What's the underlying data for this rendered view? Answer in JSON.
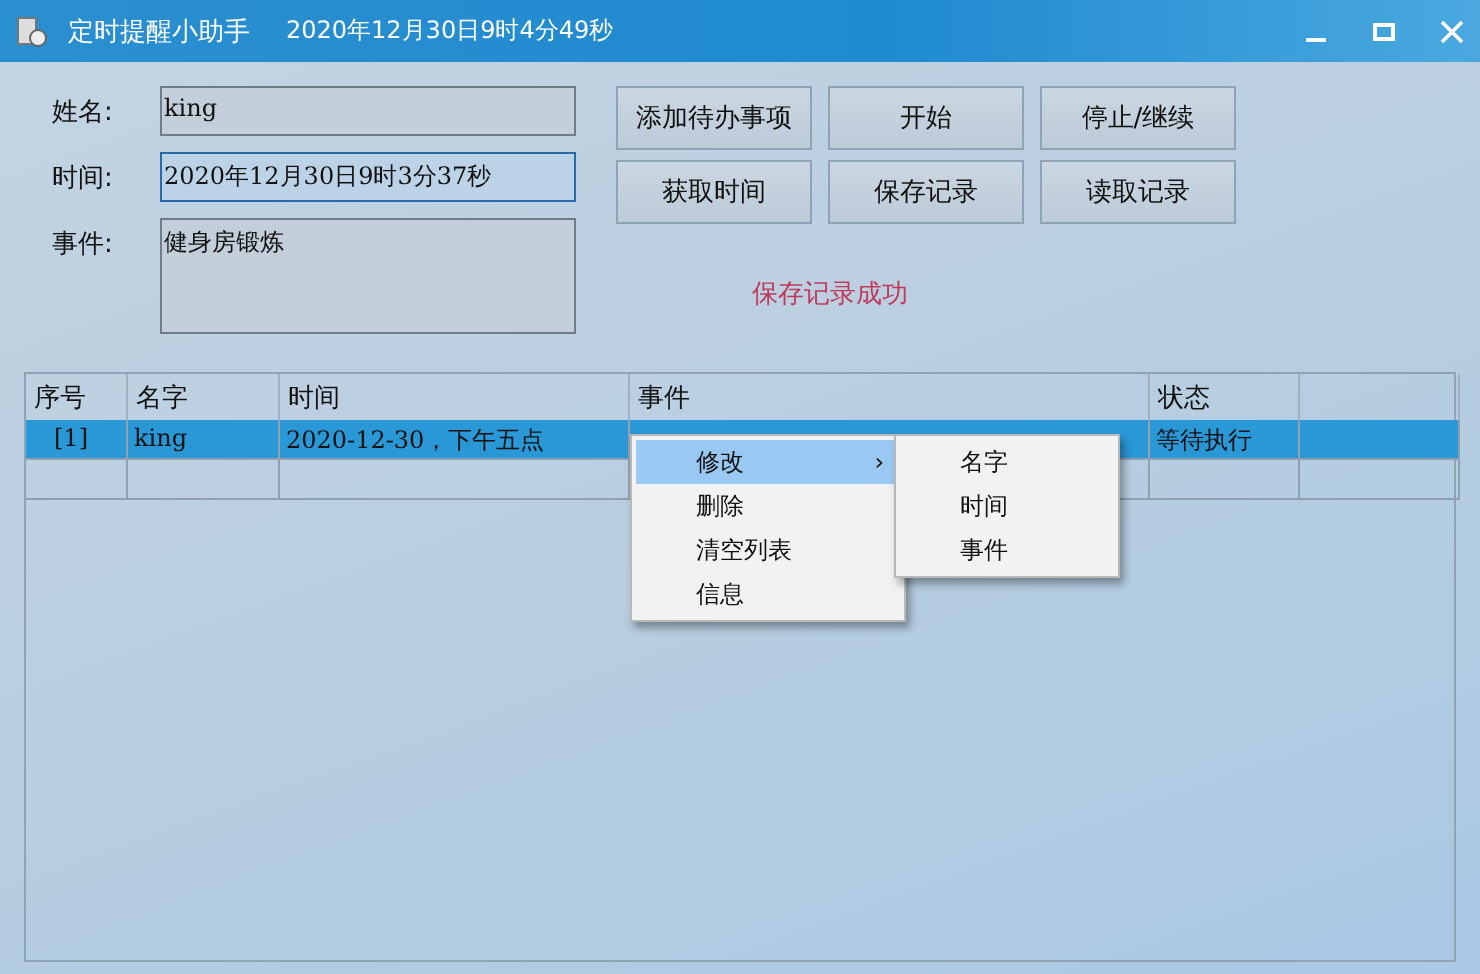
{
  "window": {
    "title": "定时提醒小助手",
    "clock": "2020年12月30日9时4分49秒"
  },
  "form": {
    "fields": [
      {
        "label": "姓名:",
        "value": "king",
        "kind": "line",
        "focused": false
      },
      {
        "label": "时间:",
        "value": "2020年12月30日9时3分37秒",
        "kind": "line",
        "focused": true
      },
      {
        "label": "事件:",
        "value": "健身房锻炼",
        "kind": "area",
        "focused": false
      }
    ]
  },
  "buttons": [
    [
      "添加待办事项",
      "开始",
      "停止/继续"
    ],
    [
      "获取时间",
      "保存记录",
      "读取记录"
    ]
  ],
  "message": "保存记录成功",
  "table": {
    "columns": [
      "序号",
      "名字",
      "时间",
      "事件",
      "状态"
    ],
    "rows": [
      {
        "cells": [
          "[1]",
          "king",
          "2020-12-30，下午五点",
          "",
          "等待执行"
        ],
        "selected": true
      }
    ]
  },
  "context_menu": {
    "items": [
      {
        "label": "修改",
        "arrow": "›",
        "highlighted": true
      },
      {
        "label": "删除",
        "highlighted": false
      },
      {
        "label": "清空列表",
        "highlighted": false
      },
      {
        "label": "信息",
        "highlighted": false
      }
    ],
    "submenu": [
      "名字",
      "时间",
      "事件"
    ]
  }
}
